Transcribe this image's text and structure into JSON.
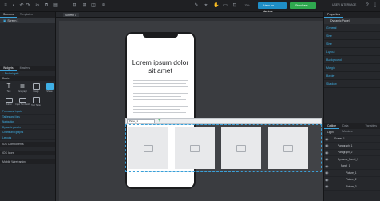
{
  "toolbar": {
    "view_button": "View on device",
    "simulate_button": "Simulate",
    "user_label": "USER INTERFACE",
    "zoom": "70%"
  },
  "left_panel": {
    "tabs": [
      "Screens",
      "Templates"
    ],
    "screen_item": "Screen 1",
    "widget_tabs": [
      "Widgets",
      "Masters"
    ],
    "widget_search": "Find widgets",
    "basic_header": "Basic",
    "widgets": [
      "Text",
      "Paragraph",
      "Image",
      "Shape",
      "Button",
      "Input Text Field",
      "Text Table",
      ""
    ],
    "libraries": [
      "Forms and inputs",
      "Tables and lists",
      "Navigation",
      "Dynamic panels",
      "Charts and graphs",
      "Layouts"
    ],
    "sections": [
      "iOS Components",
      "iOS Icons",
      "Mobile Wireframing"
    ]
  },
  "canvas": {
    "tab_label": "Screen 1",
    "headline": "Lorem ipsum dolor sit amet",
    "panel_select": "Panel_1",
    "panel_plus": "+"
  },
  "right_panel": {
    "tabs": [
      "Properties"
    ],
    "selected": "Dynamic Panel",
    "props": [
      "General",
      "Size",
      "Size",
      "Layout",
      "Background",
      "Margin",
      "Border",
      "Shadow"
    ],
    "outline_tabs": [
      "Outline",
      "Data Masters",
      "Variables"
    ],
    "outline_items": [
      "Login",
      "Screen 1",
      "Paragraph_1",
      "Paragraph_2",
      "Dynamic_Panel_1",
      "Panel_1",
      "Picture_1",
      "Picture_2",
      "Picture_3"
    ]
  }
}
